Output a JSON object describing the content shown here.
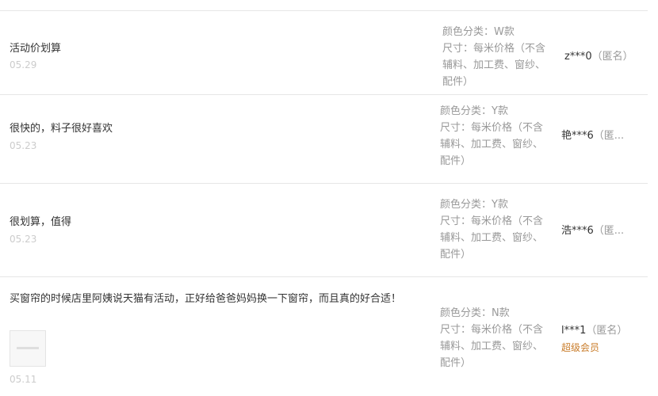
{
  "reviews": [
    {
      "content": "活动价划算",
      "date": "05.29",
      "sku_color": "颜色分类：W款",
      "sku_size": "尺寸：每米价格（不含辅料、加工费、窗纱、配件）",
      "user": "z***0",
      "anon": "（匿名）"
    },
    {
      "content": "很快的，料子很好喜欢",
      "date": "05.23",
      "sku_color": "颜色分类：Y款",
      "sku_size": "尺寸：每米价格（不含辅料、加工费、窗纱、配件）",
      "user": "艳***6",
      "anon": "（匿..."
    },
    {
      "content": "很划算，值得",
      "date": "05.23",
      "sku_color": "颜色分类：Y款",
      "sku_size": "尺寸：每米价格（不含辅料、加工费、窗纱、配件）",
      "user": "浩***6",
      "anon": "（匿..."
    },
    {
      "content": "买窗帘的时候店里阿姨说天猫有活动，正好给爸爸妈妈换一下窗帘，而且真的好合适！",
      "date": "05.11",
      "sku_color": "颜色分类：N款",
      "sku_size": "尺寸：每米价格（不含辅料、加工费、窗纱、配件）",
      "user": "l***1",
      "anon": "（匿名）",
      "badge": "超级会员"
    }
  ]
}
